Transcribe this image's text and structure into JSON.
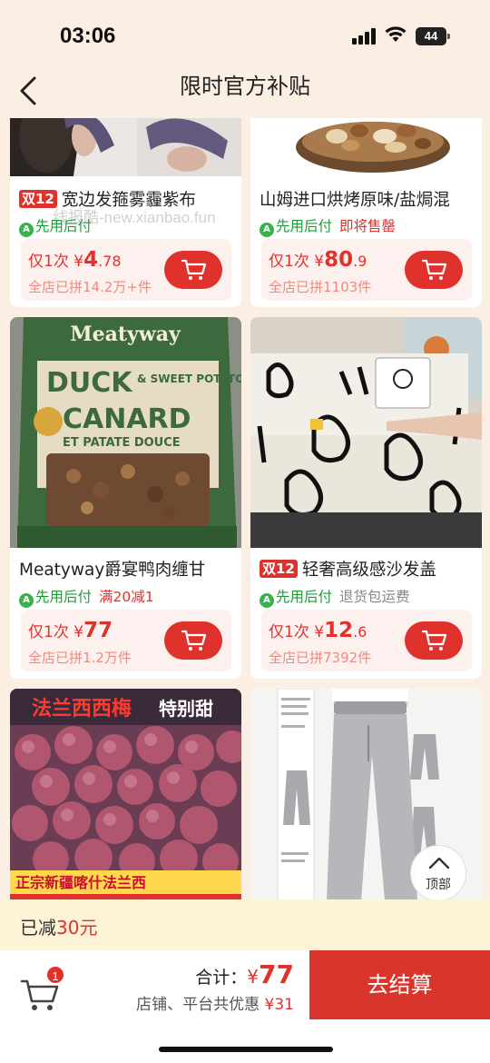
{
  "status_bar": {
    "time": "03:06",
    "battery": "44"
  },
  "nav": {
    "title": "限时官方补贴"
  },
  "watermark": "线报酷-new.xianbao.fun",
  "products": [
    {
      "badge": "双12",
      "name": "宽边发箍雾霾紫布",
      "pay_later": "先用后付",
      "extra": "",
      "price_prefix": "仅1次",
      "currency": "¥",
      "price_int": "4",
      "price_dec": ".78",
      "sold": "全店已拼14.2万+件"
    },
    {
      "badge": "",
      "name": "山姆进口烘烤原味/盐焗混",
      "pay_later": "先用后付",
      "extra": "即将售罄",
      "price_prefix": "仅1次",
      "currency": "¥",
      "price_int": "80",
      "price_dec": ".9",
      "sold": "全店已拼1103件"
    },
    {
      "badge": "",
      "name": "Meatyway爵宴鸭肉缠甘",
      "pay_later": "先用后付",
      "extra": "满20减1",
      "price_prefix": "仅1次",
      "currency": "¥",
      "price_int": "77",
      "price_dec": "",
      "sold": "全店已拼1.2万件"
    },
    {
      "badge": "双12",
      "name": "轻奢高级感沙发盖",
      "pay_later": "先用后付",
      "extra": "退货包运费",
      "price_prefix": "仅1次",
      "currency": "¥",
      "price_int": "12",
      "price_dec": ".6",
      "sold": "全店已拼7392件"
    }
  ],
  "image_text": {
    "duck_brand": "Meatyway",
    "duck_line1": "DUCK",
    "duck_line2": "& SWEET POTATO",
    "duck_line3": "CANARD",
    "duck_line4": "ET PATATE DOUCE",
    "plum_title": "法兰西西梅",
    "plum_sub": "特别甜",
    "plum_bottom": "正宗新疆喀什法兰西"
  },
  "top_button": {
    "label": "顶部"
  },
  "saved_bar": {
    "prefix": "已减",
    "amount": "30元"
  },
  "checkout": {
    "cart_count": "1",
    "total_label": "合计：",
    "currency": "¥",
    "total_amount": "77",
    "discount_label": "店铺、平台共优惠",
    "discount_amount": "¥31",
    "pay_label": "去结算"
  },
  "colors": {
    "accent": "#e0322c",
    "page_bg": "#fbeee3",
    "pay_later": "#1f9b3a"
  }
}
